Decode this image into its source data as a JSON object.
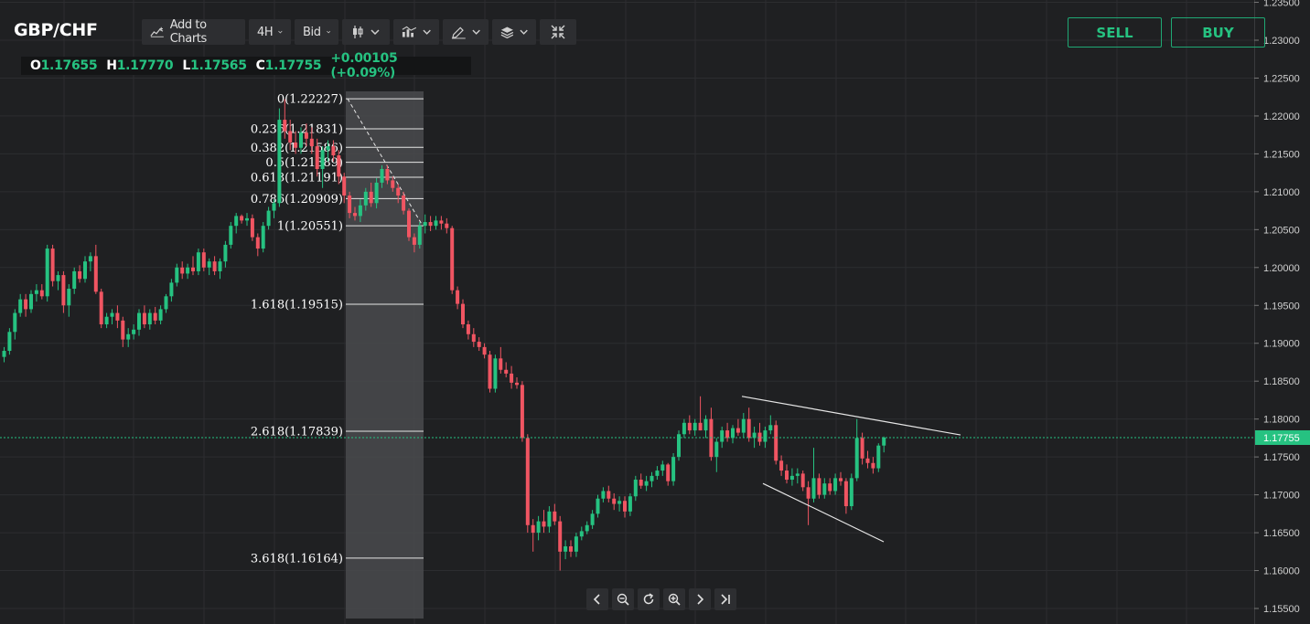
{
  "symbol": "GBP/CHF",
  "toolbar": {
    "add_to_charts": "Add to Charts",
    "timeframe": "4H",
    "price_type": "Bid",
    "icons": [
      "chart-add-icon",
      "candlestick-icon",
      "indicators-icon",
      "drawing-pen-icon",
      "layers-icon",
      "collapse-arrows-icon"
    ]
  },
  "ohlc": {
    "o_label": "O",
    "o": "1.17655",
    "h_label": "H",
    "h": "1.17770",
    "l_label": "L",
    "l": "1.17565",
    "c_label": "C",
    "c": "1.17755",
    "change": "+0.00105 (+0.09%)"
  },
  "trade": {
    "sell": "SELL",
    "buy": "BUY"
  },
  "colors": {
    "up": "#26c281",
    "down": "#f05562",
    "accent": "#1fa874",
    "background": "#1f2022",
    "grid": "#2c2d30"
  },
  "nav_icons": [
    "chevron-left-icon",
    "zoom-out-icon",
    "reset-icon",
    "zoom-in-icon",
    "chevron-right-icon",
    "jump-to-end-icon"
  ],
  "chart_data": {
    "type": "candlestick",
    "ylim": [
      1.155,
      1.235
    ],
    "y_ticks": [
      "1.23500",
      "1.23000",
      "1.22500",
      "1.22000",
      "1.21500",
      "1.21000",
      "1.20500",
      "1.20000",
      "1.19500",
      "1.19000",
      "1.18500",
      "1.18000",
      "1.17500",
      "1.17000",
      "1.16500",
      "1.16000",
      "1.15500"
    ],
    "current_price": "1.17755",
    "fibonacci": {
      "levels": [
        {
          "label": "0(1.22227)",
          "value": 1.22227
        },
        {
          "label": "0.236(1.21831)",
          "value": 1.21831
        },
        {
          "label": "0.382(1.21586)",
          "value": 1.21586
        },
        {
          "label": "0.5(1.21389)",
          "value": 1.21389
        },
        {
          "label": "0.618(1.21191)",
          "value": 1.21191
        },
        {
          "label": "0.786(1.20909)",
          "value": 1.20909
        },
        {
          "label": "1(1.20551)",
          "value": 1.20551
        },
        {
          "label": "1.618(1.19515)",
          "value": 1.19515
        },
        {
          "label": "2.618(1.17839)",
          "value": 1.17839
        },
        {
          "label": "3.618(1.16164)",
          "value": 1.16164
        }
      ],
      "anchor_start": {
        "value": 1.22227
      },
      "anchor_end": {
        "value": 1.20551
      }
    },
    "trendlines": [
      {
        "from": [
          1.183,
          0
        ],
        "to": [
          1.1779,
          1
        ]
      },
      {
        "from": [
          1.1715,
          0
        ],
        "to": [
          1.1638,
          1
        ]
      }
    ],
    "candles": [
      {
        "o": 1.1882,
        "h": 1.1895,
        "l": 1.1875,
        "c": 1.189
      },
      {
        "o": 1.189,
        "h": 1.192,
        "l": 1.1885,
        "c": 1.1915
      },
      {
        "o": 1.1915,
        "h": 1.1945,
        "l": 1.1905,
        "c": 1.194
      },
      {
        "o": 1.194,
        "h": 1.1965,
        "l": 1.1935,
        "c": 1.1958
      },
      {
        "o": 1.1958,
        "h": 1.1965,
        "l": 1.1935,
        "c": 1.1945
      },
      {
        "o": 1.1945,
        "h": 1.197,
        "l": 1.194,
        "c": 1.1965
      },
      {
        "o": 1.1965,
        "h": 1.1978,
        "l": 1.1955,
        "c": 1.197
      },
      {
        "o": 1.197,
        "h": 1.1978,
        "l": 1.1958,
        "c": 1.1962
      },
      {
        "o": 1.1962,
        "h": 1.203,
        "l": 1.1955,
        "c": 1.2025
      },
      {
        "o": 1.2025,
        "h": 1.203,
        "l": 1.1975,
        "c": 1.1982
      },
      {
        "o": 1.1982,
        "h": 1.1995,
        "l": 1.197,
        "c": 1.199
      },
      {
        "o": 1.199,
        "h": 1.1995,
        "l": 1.194,
        "c": 1.195
      },
      {
        "o": 1.195,
        "h": 1.1978,
        "l": 1.1935,
        "c": 1.1972
      },
      {
        "o": 1.1972,
        "h": 1.2,
        "l": 1.1965,
        "c": 1.1995
      },
      {
        "o": 1.1995,
        "h": 1.2003,
        "l": 1.198,
        "c": 1.1985
      },
      {
        "o": 1.1985,
        "h": 1.2015,
        "l": 1.198,
        "c": 1.2008
      },
      {
        "o": 1.2008,
        "h": 1.202,
        "l": 1.1995,
        "c": 1.2015
      },
      {
        "o": 1.2015,
        "h": 1.203,
        "l": 1.1965,
        "c": 1.1968
      },
      {
        "o": 1.1968,
        "h": 1.1972,
        "l": 1.192,
        "c": 1.1925
      },
      {
        "o": 1.1925,
        "h": 1.194,
        "l": 1.192,
        "c": 1.1935
      },
      {
        "o": 1.1935,
        "h": 1.1945,
        "l": 1.1925,
        "c": 1.194
      },
      {
        "o": 1.194,
        "h": 1.195,
        "l": 1.192,
        "c": 1.193
      },
      {
        "o": 1.193,
        "h": 1.1935,
        "l": 1.1895,
        "c": 1.1905
      },
      {
        "o": 1.1905,
        "h": 1.192,
        "l": 1.1895,
        "c": 1.1912
      },
      {
        "o": 1.1912,
        "h": 1.1925,
        "l": 1.1905,
        "c": 1.1918
      },
      {
        "o": 1.1918,
        "h": 1.1945,
        "l": 1.191,
        "c": 1.194
      },
      {
        "o": 1.194,
        "h": 1.195,
        "l": 1.192,
        "c": 1.1925
      },
      {
        "o": 1.1925,
        "h": 1.1945,
        "l": 1.1918,
        "c": 1.194
      },
      {
        "o": 1.194,
        "h": 1.1948,
        "l": 1.1925,
        "c": 1.193
      },
      {
        "o": 1.193,
        "h": 1.195,
        "l": 1.1925,
        "c": 1.1945
      },
      {
        "o": 1.1945,
        "h": 1.1965,
        "l": 1.194,
        "c": 1.1962
      },
      {
        "o": 1.1962,
        "h": 1.1985,
        "l": 1.1955,
        "c": 1.198
      },
      {
        "o": 1.198,
        "h": 1.2005,
        "l": 1.1975,
        "c": 1.2
      },
      {
        "o": 1.2,
        "h": 1.2008,
        "l": 1.1985,
        "c": 1.1992
      },
      {
        "o": 1.1992,
        "h": 1.2005,
        "l": 1.1985,
        "c": 1.2
      },
      {
        "o": 1.2,
        "h": 1.2015,
        "l": 1.199,
        "c": 1.1995
      },
      {
        "o": 1.1995,
        "h": 1.2025,
        "l": 1.199,
        "c": 1.202
      },
      {
        "o": 1.202,
        "h": 1.2025,
        "l": 1.1995,
        "c": 1.2
      },
      {
        "o": 1.2,
        "h": 1.2012,
        "l": 1.199,
        "c": 1.2008
      },
      {
        "o": 1.2008,
        "h": 1.2015,
        "l": 1.199,
        "c": 1.1995
      },
      {
        "o": 1.1995,
        "h": 1.2012,
        "l": 1.1985,
        "c": 1.2008
      },
      {
        "o": 1.2008,
        "h": 1.2035,
        "l": 1.2,
        "c": 1.203
      },
      {
        "o": 1.203,
        "h": 1.206,
        "l": 1.2025,
        "c": 1.2055
      },
      {
        "o": 1.2055,
        "h": 1.2072,
        "l": 1.2045,
        "c": 1.2068
      },
      {
        "o": 1.2068,
        "h": 1.207,
        "l": 1.2058,
        "c": 1.2062
      },
      {
        "o": 1.2062,
        "h": 1.2072,
        "l": 1.2055,
        "c": 1.2065
      },
      {
        "o": 1.2065,
        "h": 1.207,
        "l": 1.2035,
        "c": 1.204
      },
      {
        "o": 1.204,
        "h": 1.2045,
        "l": 1.2015,
        "c": 1.2025
      },
      {
        "o": 1.2025,
        "h": 1.206,
        "l": 1.202,
        "c": 1.2055
      },
      {
        "o": 1.2055,
        "h": 1.208,
        "l": 1.205,
        "c": 1.2075
      },
      {
        "o": 1.2075,
        "h": 1.209,
        "l": 1.2065,
        "c": 1.2085
      },
      {
        "o": 1.2085,
        "h": 1.221,
        "l": 1.208,
        "c": 1.2195
      },
      {
        "o": 1.2195,
        "h": 1.2222,
        "l": 1.217,
        "c": 1.218
      },
      {
        "o": 1.218,
        "h": 1.2195,
        "l": 1.2155,
        "c": 1.2165
      },
      {
        "o": 1.2165,
        "h": 1.218,
        "l": 1.215,
        "c": 1.2158
      },
      {
        "o": 1.2158,
        "h": 1.2185,
        "l": 1.215,
        "c": 1.2178
      },
      {
        "o": 1.2178,
        "h": 1.219,
        "l": 1.216,
        "c": 1.217
      },
      {
        "o": 1.217,
        "h": 1.2185,
        "l": 1.215,
        "c": 1.216
      },
      {
        "o": 1.216,
        "h": 1.217,
        "l": 1.212,
        "c": 1.213
      },
      {
        "o": 1.213,
        "h": 1.216,
        "l": 1.2105,
        "c": 1.2155
      },
      {
        "o": 1.2155,
        "h": 1.2168,
        "l": 1.214,
        "c": 1.216
      },
      {
        "o": 1.216,
        "h": 1.2168,
        "l": 1.214,
        "c": 1.2148
      },
      {
        "o": 1.2148,
        "h": 1.2155,
        "l": 1.211,
        "c": 1.212
      },
      {
        "o": 1.212,
        "h": 1.2125,
        "l": 1.2085,
        "c": 1.2095
      },
      {
        "o": 1.2095,
        "h": 1.21,
        "l": 1.2065,
        "c": 1.2072
      },
      {
        "o": 1.2072,
        "h": 1.208,
        "l": 1.2062,
        "c": 1.2068
      },
      {
        "o": 1.2068,
        "h": 1.209,
        "l": 1.206,
        "c": 1.2082
      },
      {
        "o": 1.2082,
        "h": 1.2105,
        "l": 1.2075,
        "c": 1.21
      },
      {
        "o": 1.21,
        "h": 1.2112,
        "l": 1.208,
        "c": 1.2085
      },
      {
        "o": 1.2085,
        "h": 1.2118,
        "l": 1.2078,
        "c": 1.2112
      },
      {
        "o": 1.2112,
        "h": 1.2135,
        "l": 1.2105,
        "c": 1.213
      },
      {
        "o": 1.213,
        "h": 1.2135,
        "l": 1.211,
        "c": 1.2115
      },
      {
        "o": 1.2115,
        "h": 1.212,
        "l": 1.21,
        "c": 1.2105
      },
      {
        "o": 1.2105,
        "h": 1.211,
        "l": 1.2085,
        "c": 1.2095
      },
      {
        "o": 1.2095,
        "h": 1.21,
        "l": 1.207,
        "c": 1.2075
      },
      {
        "o": 1.2075,
        "h": 1.2078,
        "l": 1.2035,
        "c": 1.204
      },
      {
        "o": 1.204,
        "h": 1.2045,
        "l": 1.202,
        "c": 1.203
      },
      {
        "o": 1.203,
        "h": 1.206,
        "l": 1.2025,
        "c": 1.2055
      },
      {
        "o": 1.2055,
        "h": 1.207,
        "l": 1.2045,
        "c": 1.206
      },
      {
        "o": 1.206,
        "h": 1.2068,
        "l": 1.2048,
        "c": 1.2055
      },
      {
        "o": 1.2055,
        "h": 1.2068,
        "l": 1.205,
        "c": 1.2062
      },
      {
        "o": 1.2062,
        "h": 1.2068,
        "l": 1.205,
        "c": 1.2058
      },
      {
        "o": 1.2058,
        "h": 1.2065,
        "l": 1.2045,
        "c": 1.2052
      },
      {
        "o": 1.2052,
        "h": 1.2055,
        "l": 1.1965,
        "c": 1.197
      },
      {
        "o": 1.197,
        "h": 1.1975,
        "l": 1.1945,
        "c": 1.1952
      },
      {
        "o": 1.1952,
        "h": 1.1958,
        "l": 1.192,
        "c": 1.1925
      },
      {
        "o": 1.1925,
        "h": 1.193,
        "l": 1.1905,
        "c": 1.1912
      },
      {
        "o": 1.1912,
        "h": 1.192,
        "l": 1.1895,
        "c": 1.1902
      },
      {
        "o": 1.1902,
        "h": 1.1908,
        "l": 1.189,
        "c": 1.1895
      },
      {
        "o": 1.1895,
        "h": 1.19,
        "l": 1.188,
        "c": 1.1885
      },
      {
        "o": 1.1885,
        "h": 1.189,
        "l": 1.1835,
        "c": 1.184
      },
      {
        "o": 1.184,
        "h": 1.1885,
        "l": 1.1835,
        "c": 1.188
      },
      {
        "o": 1.188,
        "h": 1.1895,
        "l": 1.186,
        "c": 1.1865
      },
      {
        "o": 1.1865,
        "h": 1.1875,
        "l": 1.1855,
        "c": 1.186
      },
      {
        "o": 1.186,
        "h": 1.187,
        "l": 1.184,
        "c": 1.1848
      },
      {
        "o": 1.1848,
        "h": 1.1855,
        "l": 1.184,
        "c": 1.1845
      },
      {
        "o": 1.1845,
        "h": 1.185,
        "l": 1.177,
        "c": 1.1775
      },
      {
        "o": 1.1775,
        "h": 1.178,
        "l": 1.165,
        "c": 1.166
      },
      {
        "o": 1.166,
        "h": 1.1668,
        "l": 1.1625,
        "c": 1.165
      },
      {
        "o": 1.165,
        "h": 1.1672,
        "l": 1.164,
        "c": 1.1665
      },
      {
        "o": 1.1665,
        "h": 1.168,
        "l": 1.165,
        "c": 1.1658
      },
      {
        "o": 1.1658,
        "h": 1.1685,
        "l": 1.165,
        "c": 1.1678
      },
      {
        "o": 1.1678,
        "h": 1.1688,
        "l": 1.166,
        "c": 1.1665
      },
      {
        "o": 1.1665,
        "h": 1.1672,
        "l": 1.16,
        "c": 1.1625
      },
      {
        "o": 1.1625,
        "h": 1.164,
        "l": 1.1615,
        "c": 1.1632
      },
      {
        "o": 1.1632,
        "h": 1.164,
        "l": 1.1618,
        "c": 1.1625
      },
      {
        "o": 1.1625,
        "h": 1.165,
        "l": 1.1618,
        "c": 1.1645
      },
      {
        "o": 1.1645,
        "h": 1.1658,
        "l": 1.164,
        "c": 1.1652
      },
      {
        "o": 1.1652,
        "h": 1.1665,
        "l": 1.1648,
        "c": 1.166
      },
      {
        "o": 1.166,
        "h": 1.168,
        "l": 1.1655,
        "c": 1.1675
      },
      {
        "o": 1.1675,
        "h": 1.17,
        "l": 1.167,
        "c": 1.1695
      },
      {
        "o": 1.1695,
        "h": 1.171,
        "l": 1.169,
        "c": 1.1705
      },
      {
        "o": 1.1705,
        "h": 1.1712,
        "l": 1.169,
        "c": 1.1695
      },
      {
        "o": 1.1695,
        "h": 1.1702,
        "l": 1.168,
        "c": 1.1688
      },
      {
        "o": 1.1688,
        "h": 1.1698,
        "l": 1.1678,
        "c": 1.1692
      },
      {
        "o": 1.1692,
        "h": 1.1698,
        "l": 1.167,
        "c": 1.1678
      },
      {
        "o": 1.1678,
        "h": 1.1702,
        "l": 1.1672,
        "c": 1.1698
      },
      {
        "o": 1.1698,
        "h": 1.1725,
        "l": 1.1692,
        "c": 1.172
      },
      {
        "o": 1.172,
        "h": 1.1728,
        "l": 1.1708,
        "c": 1.1712
      },
      {
        "o": 1.1712,
        "h": 1.1725,
        "l": 1.1705,
        "c": 1.1718
      },
      {
        "o": 1.1718,
        "h": 1.173,
        "l": 1.171,
        "c": 1.1725
      },
      {
        "o": 1.1725,
        "h": 1.1738,
        "l": 1.172,
        "c": 1.1732
      },
      {
        "o": 1.1732,
        "h": 1.1745,
        "l": 1.1725,
        "c": 1.174
      },
      {
        "o": 1.174,
        "h": 1.1742,
        "l": 1.1712,
        "c": 1.1718
      },
      {
        "o": 1.1718,
        "h": 1.1755,
        "l": 1.1712,
        "c": 1.175
      },
      {
        "o": 1.175,
        "h": 1.1785,
        "l": 1.1745,
        "c": 1.178
      },
      {
        "o": 1.178,
        "h": 1.18,
        "l": 1.1775,
        "c": 1.1795
      },
      {
        "o": 1.1795,
        "h": 1.1805,
        "l": 1.178,
        "c": 1.1785
      },
      {
        "o": 1.1785,
        "h": 1.18,
        "l": 1.1778,
        "c": 1.1795
      },
      {
        "o": 1.1795,
        "h": 1.183,
        "l": 1.1785,
        "c": 1.1785
      },
      {
        "o": 1.1785,
        "h": 1.1805,
        "l": 1.1775,
        "c": 1.18
      },
      {
        "o": 1.18,
        "h": 1.1815,
        "l": 1.1745,
        "c": 1.175
      },
      {
        "o": 1.175,
        "h": 1.1775,
        "l": 1.173,
        "c": 1.177
      },
      {
        "o": 1.177,
        "h": 1.179,
        "l": 1.1762,
        "c": 1.1785
      },
      {
        "o": 1.1785,
        "h": 1.1795,
        "l": 1.177,
        "c": 1.1775
      },
      {
        "o": 1.1775,
        "h": 1.1792,
        "l": 1.1768,
        "c": 1.1788
      },
      {
        "o": 1.1788,
        "h": 1.18,
        "l": 1.1778,
        "c": 1.1782
      },
      {
        "o": 1.1782,
        "h": 1.1808,
        "l": 1.1775,
        "c": 1.18
      },
      {
        "o": 1.18,
        "h": 1.1815,
        "l": 1.177,
        "c": 1.1775
      },
      {
        "o": 1.1775,
        "h": 1.179,
        "l": 1.1762,
        "c": 1.1782
      },
      {
        "o": 1.1782,
        "h": 1.1795,
        "l": 1.1765,
        "c": 1.177
      },
      {
        "o": 1.177,
        "h": 1.179,
        "l": 1.1762,
        "c": 1.1785
      },
      {
        "o": 1.1785,
        "h": 1.1805,
        "l": 1.178,
        "c": 1.1792
      },
      {
        "o": 1.1792,
        "h": 1.1798,
        "l": 1.174,
        "c": 1.1745
      },
      {
        "o": 1.1745,
        "h": 1.1752,
        "l": 1.1725,
        "c": 1.1732
      },
      {
        "o": 1.1732,
        "h": 1.174,
        "l": 1.1715,
        "c": 1.172
      },
      {
        "o": 1.172,
        "h": 1.1735,
        "l": 1.1712,
        "c": 1.1725
      },
      {
        "o": 1.1725,
        "h": 1.1735,
        "l": 1.1715,
        "c": 1.1728
      },
      {
        "o": 1.1728,
        "h": 1.1732,
        "l": 1.1705,
        "c": 1.171
      },
      {
        "o": 1.171,
        "h": 1.1718,
        "l": 1.166,
        "c": 1.1695
      },
      {
        "o": 1.1695,
        "h": 1.1762,
        "l": 1.169,
        "c": 1.1722
      },
      {
        "o": 1.1722,
        "h": 1.1728,
        "l": 1.1695,
        "c": 1.17
      },
      {
        "o": 1.17,
        "h": 1.1722,
        "l": 1.1695,
        "c": 1.1715
      },
      {
        "o": 1.1715,
        "h": 1.1722,
        "l": 1.17,
        "c": 1.1705
      },
      {
        "o": 1.1705,
        "h": 1.1728,
        "l": 1.17,
        "c": 1.1722
      },
      {
        "o": 1.1722,
        "h": 1.173,
        "l": 1.1712,
        "c": 1.1718
      },
      {
        "o": 1.1718,
        "h": 1.1722,
        "l": 1.1675,
        "c": 1.1685
      },
      {
        "o": 1.1685,
        "h": 1.1728,
        "l": 1.168,
        "c": 1.1722
      },
      {
        "o": 1.1722,
        "h": 1.18,
        "l": 1.1718,
        "c": 1.1775
      },
      {
        "o": 1.1775,
        "h": 1.1782,
        "l": 1.174,
        "c": 1.1748
      },
      {
        "o": 1.1748,
        "h": 1.1758,
        "l": 1.1735,
        "c": 1.1742
      },
      {
        "o": 1.1742,
        "h": 1.175,
        "l": 1.1728,
        "c": 1.1735
      },
      {
        "o": 1.1735,
        "h": 1.1768,
        "l": 1.173,
        "c": 1.1765
      },
      {
        "o": 1.1765,
        "h": 1.1777,
        "l": 1.1756,
        "c": 1.17755
      }
    ]
  }
}
